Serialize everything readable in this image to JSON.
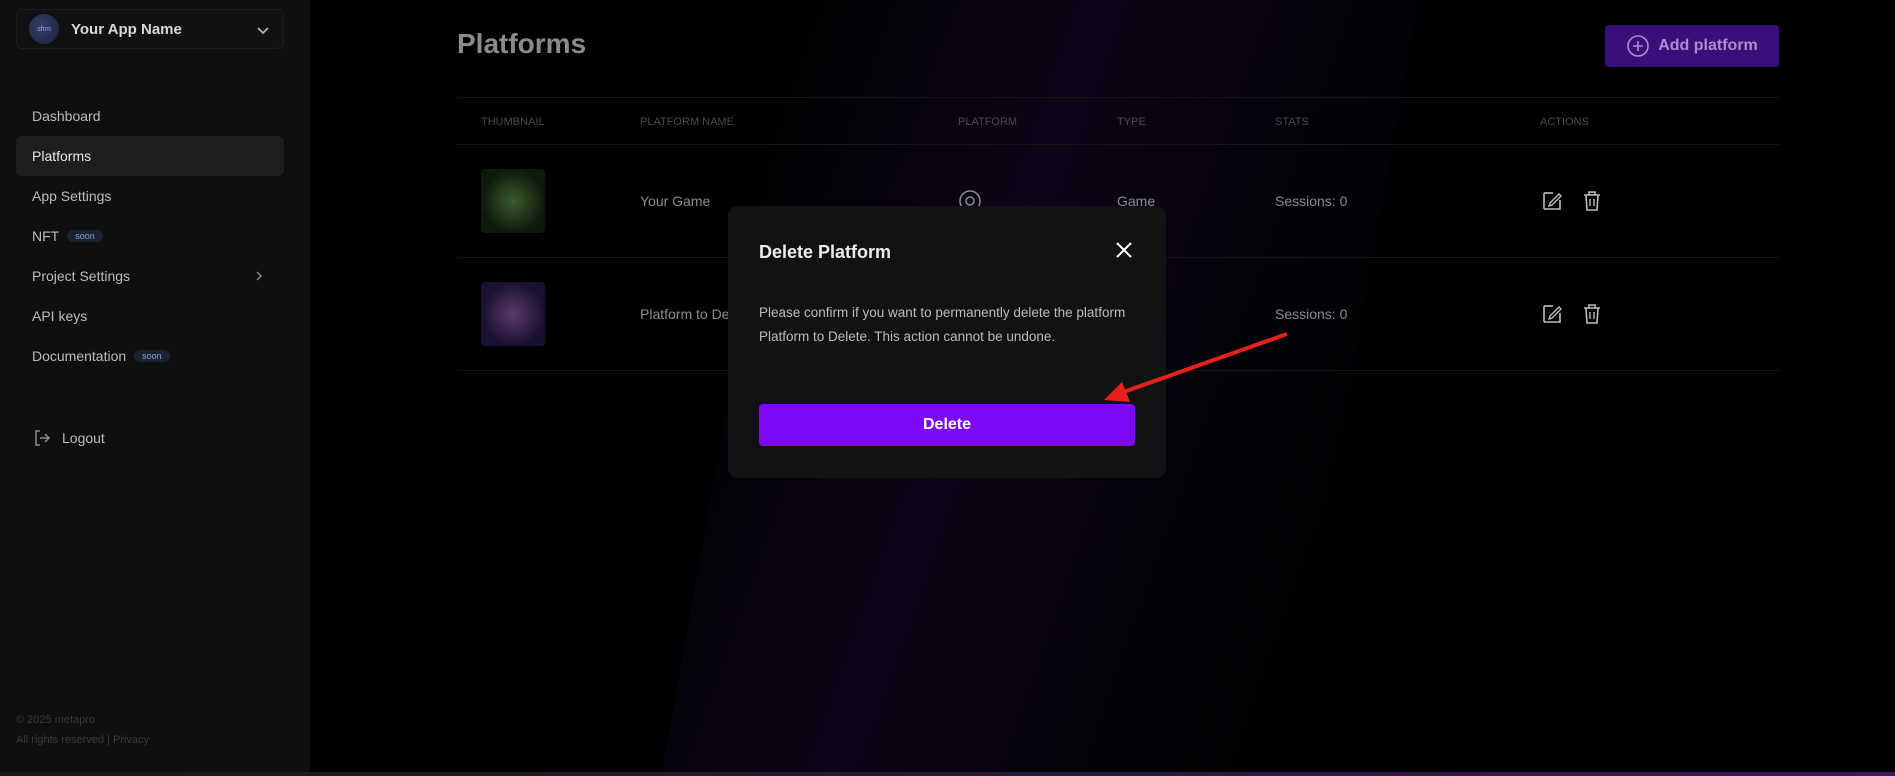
{
  "sidebar": {
    "app_name": "Your App Name",
    "avatar_text": "sfrm",
    "items": [
      {
        "label": "Dashboard"
      },
      {
        "label": "Platforms"
      },
      {
        "label": "App Settings"
      },
      {
        "label": "NFT",
        "badge": "soon"
      },
      {
        "label": "Project Settings"
      },
      {
        "label": "API keys"
      },
      {
        "label": "Documentation",
        "badge": "soon"
      }
    ],
    "logout": "Logout",
    "footer_copyright": "© 2025 metapro",
    "footer_rights": "All rights reserved | Privacy"
  },
  "main": {
    "title": "Platforms",
    "add_button": "Add platform",
    "table": {
      "headers": [
        "THUMBNAIL",
        "PLATFORM NAME",
        "PLATFORM",
        "TYPE",
        "STATS",
        "ACTIONS"
      ],
      "rows": [
        {
          "name": "Your Game",
          "type": "Game",
          "stats": "Sessions: 0"
        },
        {
          "name": "Platform to De",
          "type": "",
          "stats": "Sessions: 0"
        }
      ]
    }
  },
  "modal": {
    "title": "Delete Platform",
    "message": "Please confirm if you want to permanently delete the platform Platform to Delete. This action cannot be undone.",
    "confirm_button": "Delete"
  },
  "colors": {
    "accent": "#7c08f5",
    "annotation_arrow": "#e8201a"
  }
}
